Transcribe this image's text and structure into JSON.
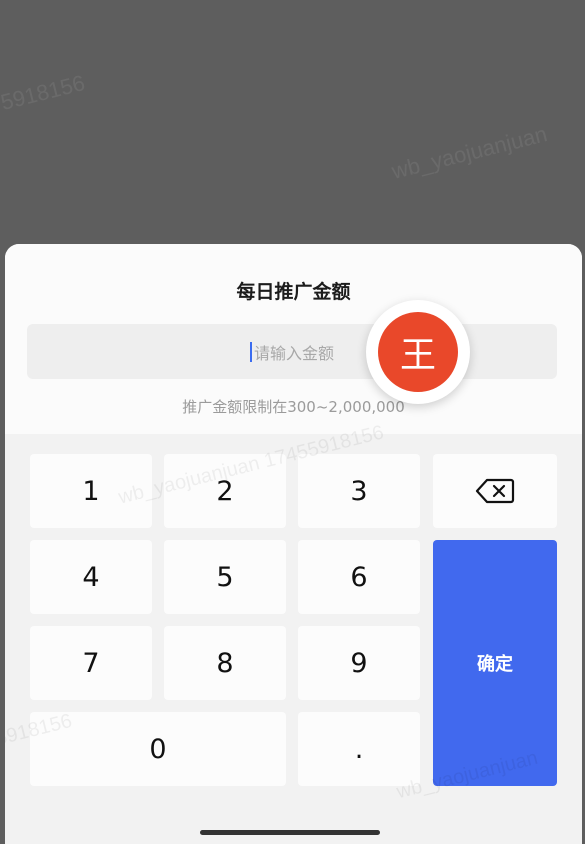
{
  "watermark": {
    "text_a": "5918156",
    "text_b": "wb_yaojuanjuan",
    "text_c": "wb_yaojuanjuan 17455918156"
  },
  "sheet": {
    "title": "每日推广金额",
    "input": {
      "placeholder": "请输入金额",
      "value": ""
    },
    "hint": "推广金额限制在300~2,000,000"
  },
  "keypad": {
    "keys": {
      "k1": "1",
      "k2": "2",
      "k3": "3",
      "k4": "4",
      "k5": "5",
      "k6": "6",
      "k7": "7",
      "k8": "8",
      "k9": "9",
      "k0": "0",
      "dot": "."
    },
    "backspace_icon": "backspace-icon",
    "confirm_label": "确定"
  },
  "avatar": {
    "label": "王",
    "color": "#e9482a"
  },
  "colors": {
    "accent": "#4169ee",
    "overlay": "#5e5e5e"
  }
}
